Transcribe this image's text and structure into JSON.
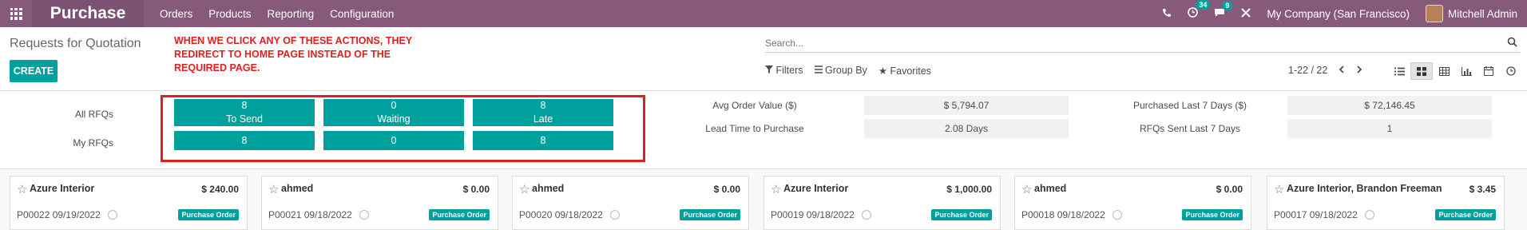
{
  "navbar": {
    "brand": "Purchase",
    "menu": [
      "Orders",
      "Products",
      "Reporting",
      "Configuration"
    ],
    "activity_badge": "34",
    "message_badge": "9",
    "company": "My Company (San Francisco)",
    "user": "Mitchell Admin"
  },
  "control": {
    "breadcrumb": "Requests for Quotation",
    "create_label": "CREATE",
    "note_lines": [
      "WHEN WE CLICK ANY OF THESE ACTIONS, THEY",
      "REDIRECT TO HOME PAGE INSTEAD OF THE",
      "REQUIRED PAGE."
    ],
    "search_placeholder": "Search...",
    "filters_label": "Filters",
    "groupby_label": "Group By",
    "favorites_label": "Favorites",
    "pager": "1-22 / 22"
  },
  "dashboard": {
    "all_rfqs_label": "All RFQs",
    "my_rfqs_label": "My RFQs",
    "tiles": [
      {
        "count": "8",
        "label": "To Send",
        "mine": "8"
      },
      {
        "count": "0",
        "label": "Waiting",
        "mine": "0"
      },
      {
        "count": "8",
        "label": "Late",
        "mine": "8"
      }
    ],
    "stats": [
      {
        "label": "Avg Order Value ($)",
        "value": "$ 5,794.07"
      },
      {
        "label": "Lead Time to Purchase",
        "value": "2.08  Days"
      },
      {
        "label": "Purchased Last 7 Days ($)",
        "value": "$ 72,146.45"
      },
      {
        "label": "RFQs Sent Last 7 Days",
        "value": "1"
      }
    ]
  },
  "cards": [
    {
      "partner": "Azure Interior",
      "amount": "$ 240.00",
      "ref": "P00022 09/19/2022",
      "state": "Purchase Order"
    },
    {
      "partner": "ahmed",
      "amount": "$ 0.00",
      "ref": "P00021 09/18/2022",
      "state": "Purchase Order"
    },
    {
      "partner": "ahmed",
      "amount": "$ 0.00",
      "ref": "P00020 09/18/2022",
      "state": "Purchase Order"
    },
    {
      "partner": "Azure Interior",
      "amount": "$ 1,000.00",
      "ref": "P00019 09/18/2022",
      "state": "Purchase Order"
    },
    {
      "partner": "ahmed",
      "amount": "$ 0.00",
      "ref": "P00018 09/18/2022",
      "state": "Purchase Order"
    },
    {
      "partner": "Azure Interior, Brandon Freeman",
      "amount": "$ 3.45",
      "ref": "P00017 09/18/2022",
      "state": "Purchase Order"
    }
  ]
}
